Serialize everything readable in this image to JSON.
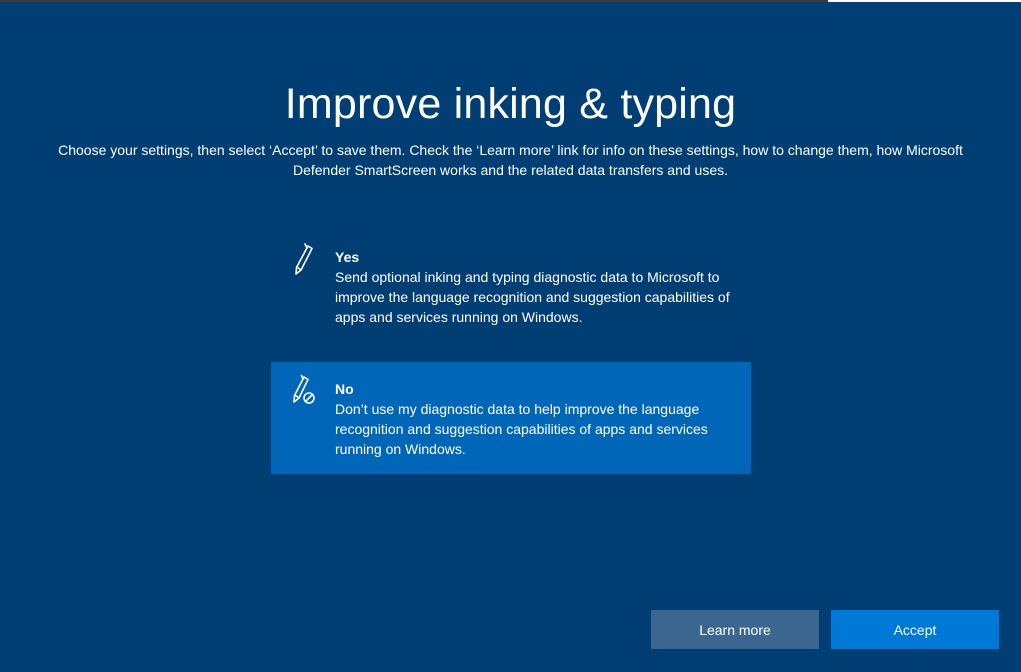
{
  "page": {
    "title": "Improve inking & typing",
    "subtitle": "Choose your settings, then select ‘Accept’ to save them. Check the ‘Learn more’ link for info on these settings, how to change them, how Microsoft Defender SmartScreen works and the related data transfers and uses."
  },
  "options": [
    {
      "heading": "Yes",
      "description": "Send optional inking and typing diagnostic data to Microsoft to improve the language recognition and suggestion capabilities of apps and services running on Windows.",
      "icon": "pen-icon",
      "selected": false
    },
    {
      "heading": "No",
      "description": "Don’t use my diagnostic data to help improve the language recognition and suggestion capabilities of apps and services running on Windows.",
      "icon": "pen-blocked-icon",
      "selected": true
    }
  ],
  "buttons": {
    "learn_more": "Learn more",
    "accept": "Accept"
  },
  "colors": {
    "background": "#003e74",
    "selected_option": "#0067b8",
    "accept_button": "#0078d7",
    "learn_more_button": "#3a6690"
  }
}
